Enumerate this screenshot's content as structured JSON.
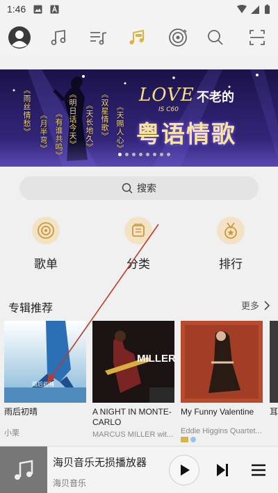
{
  "status": {
    "time": "1:46"
  },
  "nav": {
    "icons": [
      "avatar",
      "music-note-icon",
      "playlist-icon",
      "hires-music-icon",
      "radio-icon",
      "search-icon",
      "scan-icon"
    ]
  },
  "banner": {
    "love_text": "LOVE",
    "headline_small": "不老的",
    "headline_sub": "IS C60",
    "headline_big": "粤语情歌",
    "songs": [
      "《雨丝情愁》",
      "《月半弯》",
      "《有谁共鸣》",
      "《明日话今天》",
      "《天长地久》",
      "《双星情歌》",
      "《天赐人心》"
    ]
  },
  "search": {
    "label": "搜索"
  },
  "categories": [
    {
      "label": "歌单",
      "icon": "disc-icon"
    },
    {
      "label": "分类",
      "icon": "category-icon"
    },
    {
      "label": "排行",
      "icon": "medal-icon"
    }
  ],
  "albums_section": {
    "title": "专辑推荐",
    "more": "更多",
    "albums": [
      {
        "title": "雨后初晴",
        "artist": "小栗",
        "cover_text": "雨后初晴"
      },
      {
        "title": "A NIGHT IN MONTE-CARLO",
        "artist": "MARCUS MILLER wit...",
        "cover_text": "MILLER"
      },
      {
        "title": "My Funny Valentine",
        "artist": "Eddie Higgins Quartet..."
      },
      {
        "title": "耳",
        "artist": ""
      }
    ]
  },
  "player": {
    "title": "海贝音乐无损播放器",
    "subtitle": "海贝音乐"
  },
  "colors": {
    "accent": "#e1b33a",
    "category_bg": "#f3e3c4",
    "arrow": "#c0392b"
  }
}
